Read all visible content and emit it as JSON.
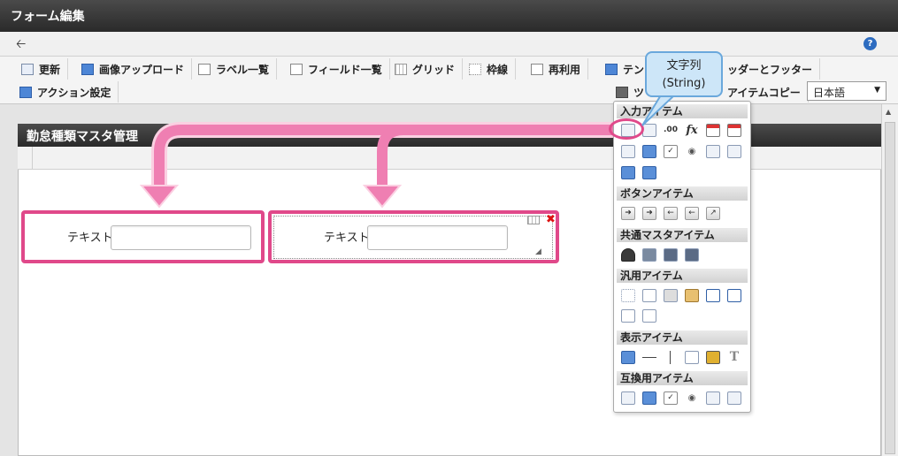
{
  "window": {
    "title": "フォーム編集"
  },
  "toolbar": {
    "update": "更新",
    "image_upload": "画像アップロード",
    "label_list": "ラベル一覧",
    "field_list": "フィールド一覧",
    "grid": "グリッド",
    "frame_line": "枠線",
    "reuse": "再利用",
    "template_partial": "テン",
    "header_footer_partial": "ッダーとフッター",
    "action_settings": "アクション設定",
    "tool_partial": "ツ",
    "item_copy_partial": "アイテムコピー",
    "language": "日本語"
  },
  "form": {
    "title_partial": "勤怠種類マスタ管理",
    "field1_label": "テキスト",
    "field2_label": "テキスト"
  },
  "tooltip": {
    "line1": "文字列",
    "line2": "(String)"
  },
  "palette": {
    "input_items": "入力アイテム",
    "button_items": "ボタンアイテム",
    "common_master_items": "共通マスタアイテム",
    "general_items": "汎用アイテム",
    "display_items": "表示アイテム",
    "compat_items": "互換用アイテム"
  },
  "colors": {
    "highlight": "#e0498a",
    "arrow": "#ef7fb2",
    "tooltip_bg": "#cde6f8",
    "header_dark": "#333333"
  }
}
